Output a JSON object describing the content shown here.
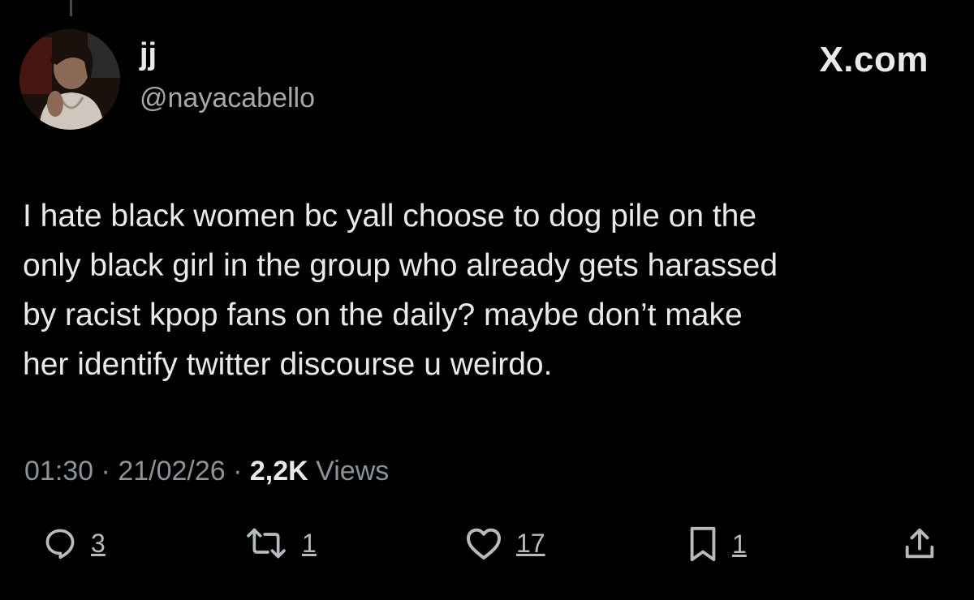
{
  "author": {
    "name": "jj",
    "handle": "@nayacabello",
    "avatar_icon": "profile-photo-avatar"
  },
  "brand": {
    "label": "X.com"
  },
  "tweet": {
    "text": "I hate black women bc yall choose to dog pile on the\nonly black girl in the group who already gets harassed\nby racist kpop fans on the daily? maybe don’t make\nher identify twitter discourse u weirdo."
  },
  "meta": {
    "time": "01:30",
    "separator_1": " · ",
    "date": "21/02/26",
    "separator_2": " · ",
    "views_count": "2,2K",
    "views_label": " Views"
  },
  "actions": {
    "reply": {
      "icon": "reply-icon",
      "count": "3"
    },
    "repost": {
      "icon": "repost-icon",
      "count": "1"
    },
    "like": {
      "icon": "heart-icon",
      "count": "17"
    },
    "bookmark": {
      "icon": "bookmark-icon",
      "count": "1"
    },
    "share": {
      "icon": "share-icon"
    }
  },
  "colors": {
    "background": "#000000",
    "text": "#e7e9ea",
    "muted": "#8b9298",
    "icon": "#b6bbbf"
  }
}
